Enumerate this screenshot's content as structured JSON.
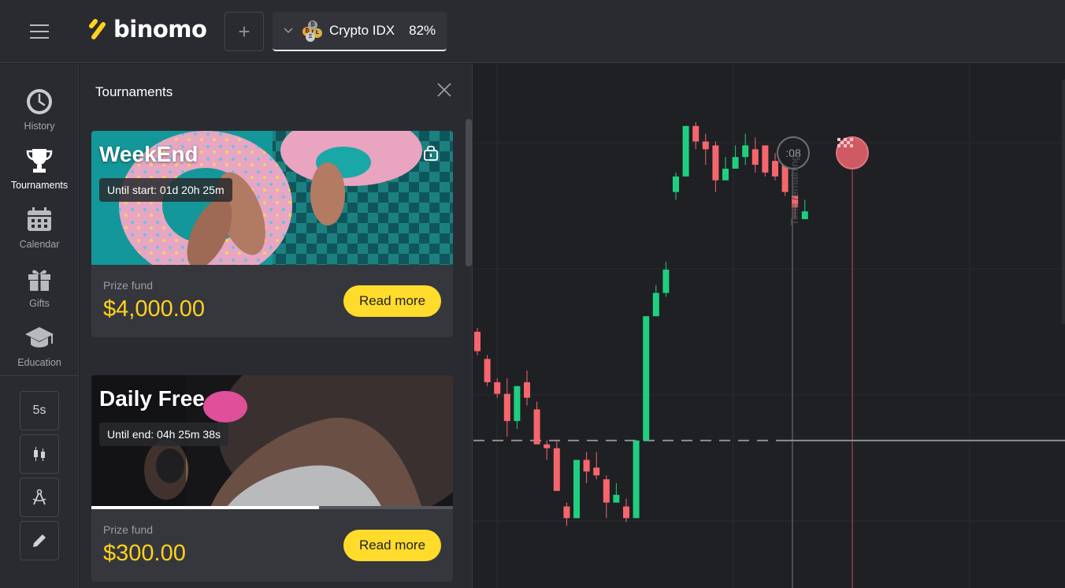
{
  "app": {
    "logo_text": "binomo",
    "brand_color": "#ffd21f"
  },
  "header": {
    "menu_icon": "hamburger-icon",
    "add_icon": "plus-icon",
    "add_label": "+",
    "asset": {
      "name": "Crypto IDX",
      "payout": "82%",
      "icon": "crypto-coins-icon"
    }
  },
  "sidebar": {
    "items": [
      {
        "label": "History",
        "icon": "clock-icon",
        "active": false
      },
      {
        "label": "Tournaments",
        "icon": "trophy-icon",
        "active": true
      },
      {
        "label": "Calendar",
        "icon": "calendar-icon",
        "active": false
      },
      {
        "label": "Gifts",
        "icon": "gift-icon",
        "active": false
      },
      {
        "label": "Education",
        "icon": "graduation-cap-icon",
        "active": false
      }
    ],
    "tools": {
      "timeframe": "5s",
      "chart_type_icon": "candlestick-icon",
      "indicators_icon": "compass-icon",
      "draw_icon": "pencil-icon"
    }
  },
  "tournaments_panel": {
    "title": "Tournaments",
    "close_icon": "close-icon",
    "cards": [
      {
        "title": "WeekEnd",
        "timer": "Until start: 01d 20h 25m",
        "locked": true,
        "prize_label": "Prize fund",
        "prize": "$4,000.00",
        "button": "Read more"
      },
      {
        "title": "Daily Free",
        "timer": "Until end: 04h 25m 38s",
        "locked": false,
        "progress": 0.63,
        "prize_label": "Prize fund",
        "prize": "$300.00",
        "button": "Read more"
      }
    ]
  },
  "chart": {
    "countdown": ":08",
    "time_remaining_label": "Time remaining",
    "finish_icon": "checkered-flag-icon",
    "up_color": "#1fcf7f",
    "down_color": "#f7656d"
  },
  "chart_data": {
    "type": "candlestick",
    "title": "",
    "xlabel": "",
    "ylabel": "",
    "grid": true,
    "current_price_line": 0.58,
    "candles": [
      {
        "o": 0.86,
        "c": 0.81,
        "h": 0.87,
        "l": 0.8
      },
      {
        "o": 0.79,
        "c": 0.73,
        "h": 0.8,
        "l": 0.72
      },
      {
        "o": 0.73,
        "c": 0.7,
        "h": 0.74,
        "l": 0.69
      },
      {
        "o": 0.7,
        "c": 0.63,
        "h": 0.74,
        "l": 0.59
      },
      {
        "o": 0.63,
        "c": 0.72,
        "h": 0.72,
        "l": 0.61
      },
      {
        "o": 0.73,
        "c": 0.69,
        "h": 0.76,
        "l": 0.67
      },
      {
        "o": 0.66,
        "c": 0.57,
        "h": 0.68,
        "l": 0.57
      },
      {
        "o": 0.57,
        "c": 0.56,
        "h": 0.58,
        "l": 0.53
      },
      {
        "o": 0.56,
        "c": 0.45,
        "h": 0.58,
        "l": 0.45
      },
      {
        "o": 0.41,
        "c": 0.38,
        "h": 0.42,
        "l": 0.36
      },
      {
        "o": 0.38,
        "c": 0.53,
        "h": 0.53,
        "l": 0.38
      },
      {
        "o": 0.53,
        "c": 0.5,
        "h": 0.55,
        "l": 0.47
      },
      {
        "o": 0.51,
        "c": 0.49,
        "h": 0.55,
        "l": 0.48
      },
      {
        "o": 0.48,
        "c": 0.42,
        "h": 0.49,
        "l": 0.38
      },
      {
        "o": 0.42,
        "c": 0.44,
        "h": 0.47,
        "l": 0.42
      },
      {
        "o": 0.41,
        "c": 0.38,
        "h": 0.43,
        "l": 0.37
      },
      {
        "o": 0.38,
        "c": 0.58,
        "h": 0.58,
        "l": 0.38
      },
      {
        "o": 0.58,
        "c": 0.9,
        "h": 0.9,
        "l": 0.58
      },
      {
        "o": 0.9,
        "c": 0.96,
        "h": 0.98,
        "l": 0.9
      },
      {
        "o": 0.96,
        "c": 1.02,
        "h": 1.04,
        "l": 0.95
      },
      {
        "o": 1.22,
        "c": 1.26,
        "h": 1.27,
        "l": 1.2
      },
      {
        "o": 1.26,
        "c": 1.39,
        "h": 1.39,
        "l": 1.26
      },
      {
        "o": 1.39,
        "c": 1.35,
        "h": 1.4,
        "l": 1.33
      },
      {
        "o": 1.35,
        "c": 1.33,
        "h": 1.37,
        "l": 1.29
      },
      {
        "o": 1.34,
        "c": 1.25,
        "h": 1.35,
        "l": 1.22
      },
      {
        "o": 1.25,
        "c": 1.28,
        "h": 1.31,
        "l": 1.25
      },
      {
        "o": 1.28,
        "c": 1.31,
        "h": 1.34,
        "l": 1.28
      },
      {
        "o": 1.31,
        "c": 1.34,
        "h": 1.37,
        "l": 1.29
      },
      {
        "o": 1.33,
        "c": 1.29,
        "h": 1.36,
        "l": 1.27
      },
      {
        "o": 1.34,
        "c": 1.27,
        "h": 1.34,
        "l": 1.26
      },
      {
        "o": 1.3,
        "c": 1.26,
        "h": 1.32,
        "l": 1.25
      },
      {
        "o": 1.29,
        "c": 1.22,
        "h": 1.3,
        "l": 1.21
      },
      {
        "o": 1.21,
        "c": 1.18,
        "h": 1.22,
        "l": 1.15
      },
      {
        "o": 1.15,
        "c": 1.17,
        "h": 1.2,
        "l": 1.15
      }
    ]
  }
}
